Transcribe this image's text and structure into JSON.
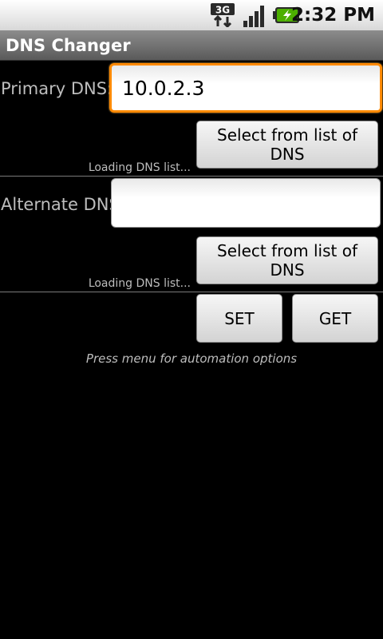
{
  "status_bar": {
    "network_label": "3G",
    "time": "2:32 PM",
    "icons": {
      "network": "3g-data-icon",
      "signal": "signal-strength-icon",
      "battery": "battery-charging-icon"
    }
  },
  "app": {
    "title": "DNS Changer"
  },
  "primary": {
    "label": "Primary DNS:",
    "value": "10.0.2.3",
    "select_button": "Select from list of DNS",
    "status": "Loading DNS list..."
  },
  "alternate": {
    "label": "Alternate DNS:",
    "value": "",
    "select_button": "Select from list of DNS",
    "status": "Loading DNS list..."
  },
  "actions": {
    "set_label": "SET",
    "get_label": "GET"
  },
  "hint": "Press menu for automation options",
  "colors": {
    "focus_border": "#ff8a00",
    "battery_green": "#4caf00",
    "background": "#000000"
  }
}
